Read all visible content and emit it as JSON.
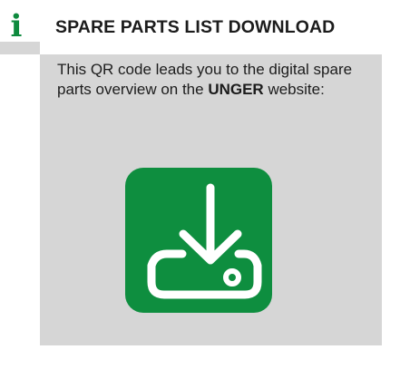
{
  "notice": {
    "icon": "info-icon",
    "icon_glyph": "i",
    "title": "SPARE PARTS LIST DOWNLOAD",
    "text_before_bold": "This QR code leads you to the digital spare parts overview on the ",
    "text_bold": "UNGER",
    "text_after_bold": " website:",
    "download_icon": "download-icon",
    "colors": {
      "accent_green": "#0e8e3f",
      "panel_gray": "#d6d6d6",
      "text": "#1c1c1c"
    }
  }
}
